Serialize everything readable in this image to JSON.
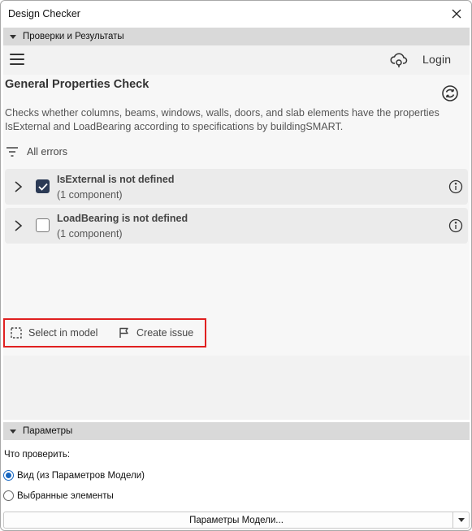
{
  "window": {
    "title": "Design Checker"
  },
  "section_checks": {
    "title": "Проверки и Результаты"
  },
  "toolbar": {
    "login_label": "Login"
  },
  "check": {
    "title": "General Properties Check",
    "description": "Checks whether columns, beams, windows, walls, doors, and slab elements have the properties IsExternal and LoadBearing according to specifications by buildingSMART."
  },
  "filter": {
    "label": "All errors"
  },
  "errors": [
    {
      "title": "IsExternal is not defined",
      "subtitle": "(1 component)",
      "checked": true
    },
    {
      "title": "LoadBearing is not defined",
      "subtitle": "(1 component)",
      "checked": false
    }
  ],
  "actions": {
    "select_in_model": "Select in model",
    "create_issue": "Create issue"
  },
  "section_params": {
    "title": "Параметры"
  },
  "params": {
    "what_to_check": "Что проверить:",
    "options": [
      {
        "label": "Вид (из Параметров Модели)",
        "selected": true
      },
      {
        "label": "Выбранные элементы",
        "selected": false
      }
    ],
    "model_params_button": "Параметры Модели..."
  },
  "colors": {
    "accent": "#2b3a55",
    "highlight": "#e02020",
    "radio": "#1565c0"
  },
  "icons": [
    "close-icon",
    "collapse-triangle-icon",
    "hamburger-menu-icon",
    "cloud-sync-icon",
    "refresh-icon",
    "filter-icon",
    "chevron-right-icon",
    "checkmark-icon",
    "info-icon",
    "selection-icon",
    "flag-icon",
    "dropdown-arrow-icon"
  ]
}
